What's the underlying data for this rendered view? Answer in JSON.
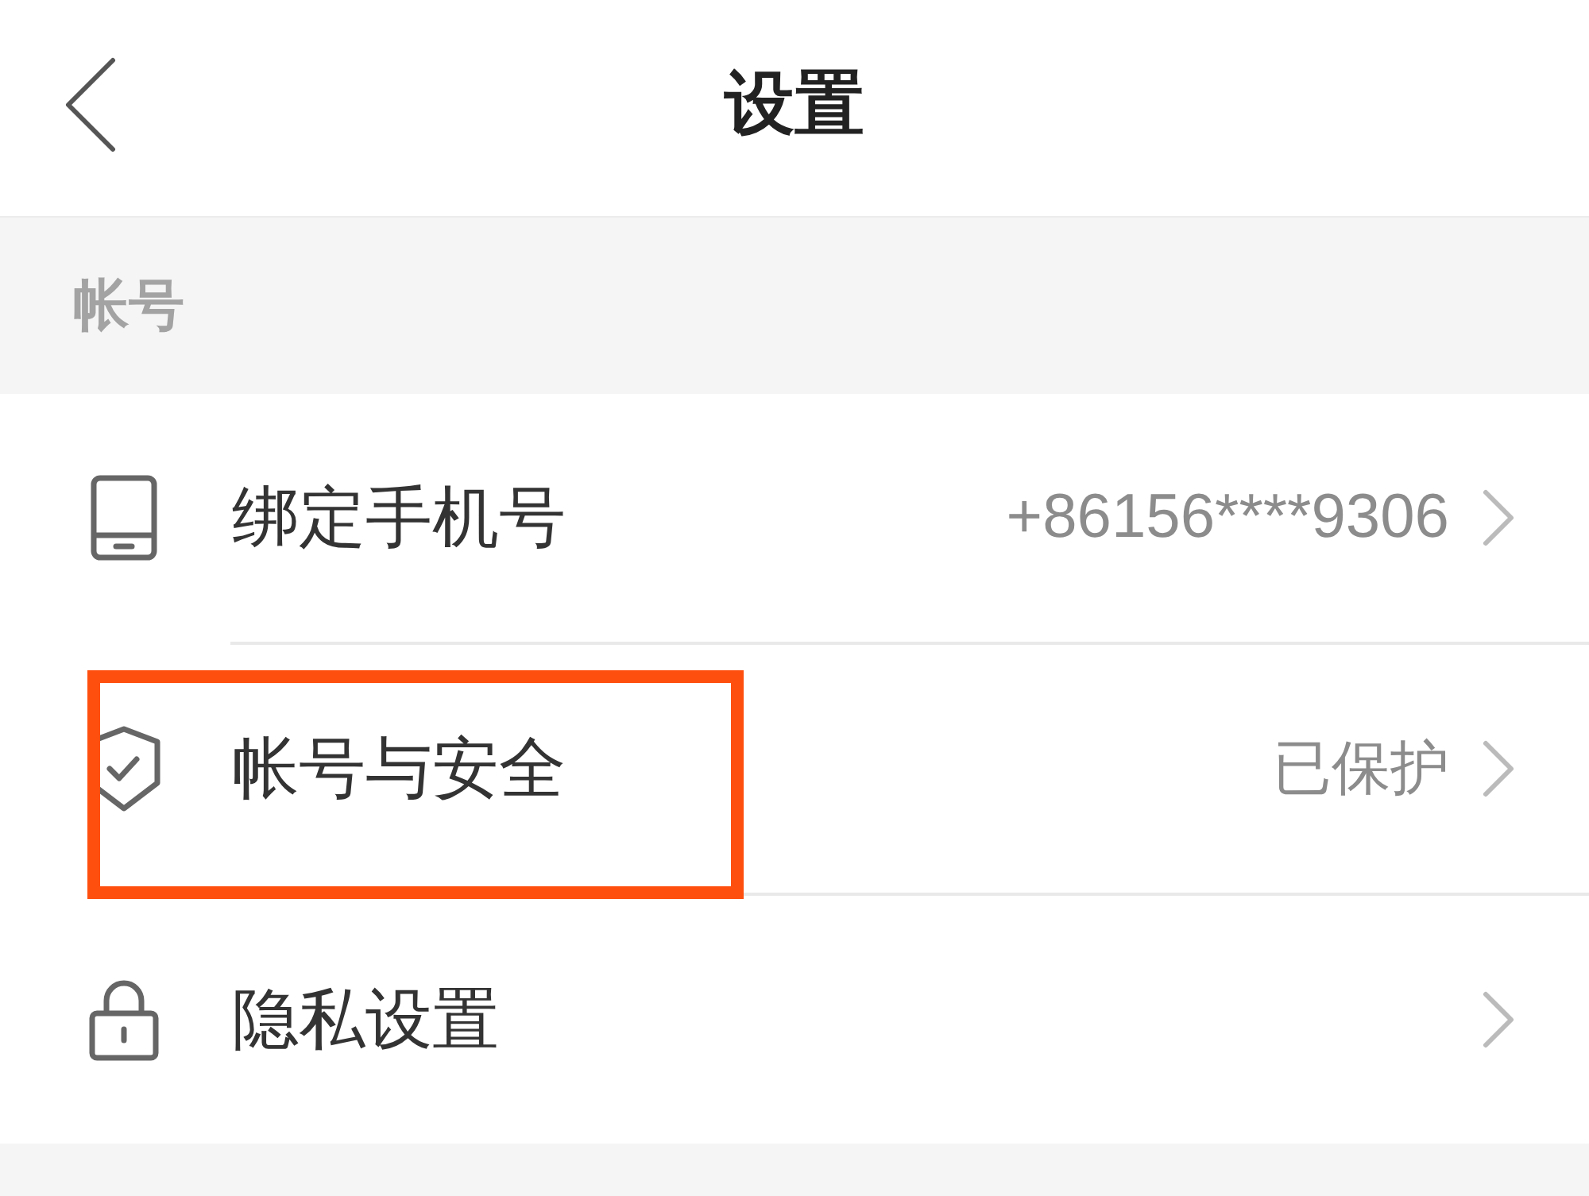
{
  "header": {
    "title": "设置"
  },
  "sections": [
    {
      "title": "帐号",
      "items": [
        {
          "kind": "phone",
          "label": "绑定手机号",
          "value": "+86156****9306",
          "highlighted": false
        },
        {
          "kind": "shield",
          "label": "帐号与安全",
          "value": "已保护",
          "highlighted": true
        },
        {
          "kind": "lock",
          "label": "隐私设置",
          "highlighted": false
        }
      ]
    }
  ]
}
